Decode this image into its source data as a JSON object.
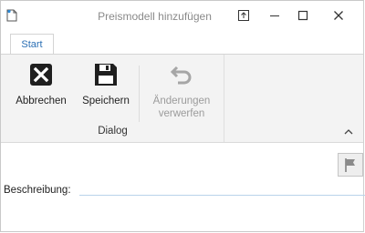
{
  "window": {
    "title": "Preismodell hinzufügen"
  },
  "titlebar_buttons": {
    "restore_icon": "restore-down-icon",
    "minimize_icon": "minimize-icon",
    "maximize_icon": "maximize-icon",
    "close_icon": "close-icon"
  },
  "ribbon": {
    "tabs": [
      {
        "label": "Start",
        "active": true
      }
    ],
    "group": {
      "label": "Dialog",
      "buttons": [
        {
          "label": "Abbrechen",
          "icon": "cancel-x-icon",
          "enabled": true
        },
        {
          "label": "Speichern",
          "icon": "save-disk-icon",
          "enabled": true
        },
        {
          "label_line1": "Änderungen",
          "label_line2": "verwerfen",
          "icon": "undo-arrow-icon",
          "enabled": false
        }
      ]
    }
  },
  "form": {
    "description_label": "Beschreibung:",
    "description_value": ""
  },
  "colors": {
    "accent": "#2b6fb4",
    "ribbon_bg": "#f3f3f3",
    "disabled_text": "#9b9b9b",
    "input_underline": "#b9d3ea"
  }
}
